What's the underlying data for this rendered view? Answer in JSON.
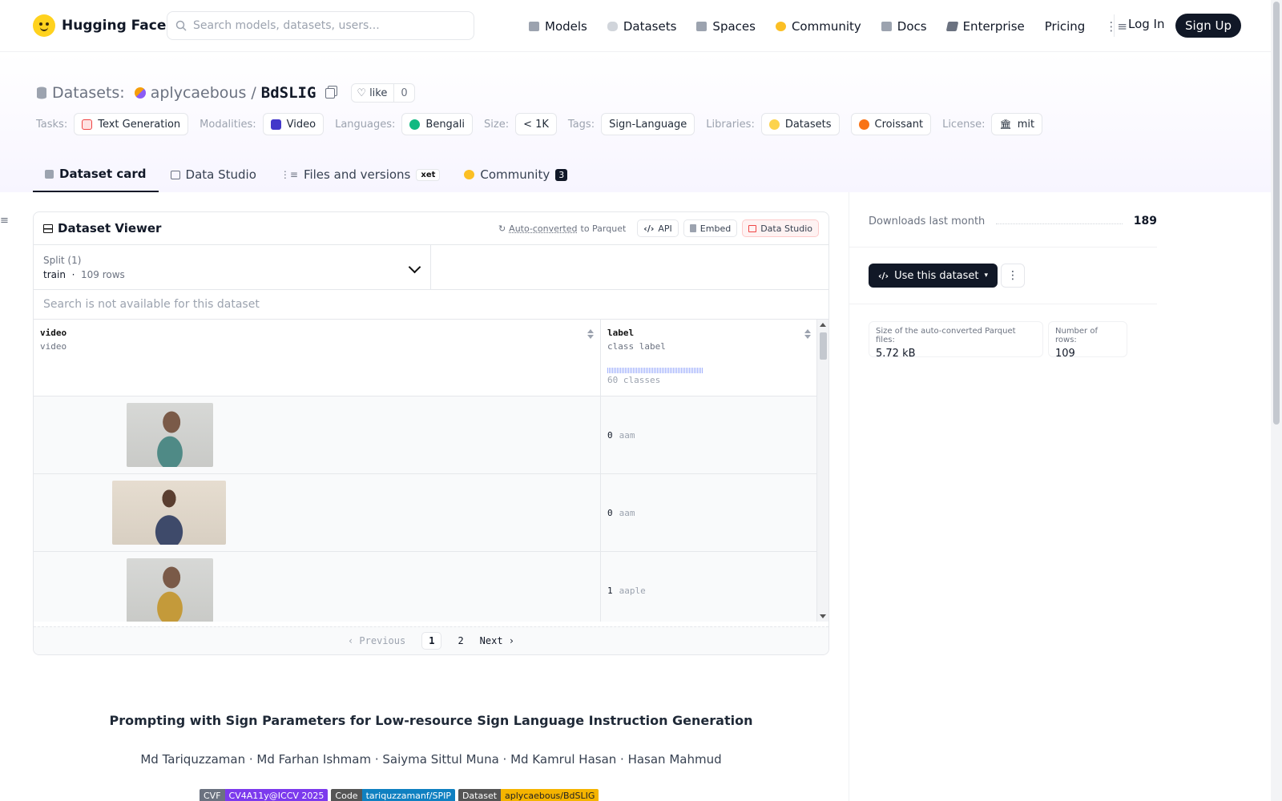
{
  "brand": {
    "name": "Hugging Face"
  },
  "search": {
    "placeholder": "Search models, datasets, users..."
  },
  "nav": {
    "items": [
      {
        "label": "Models",
        "icon": "cube-icon",
        "color": "#9ca3af"
      },
      {
        "label": "Datasets",
        "icon": "database-icon",
        "color": "#d1d5db"
      },
      {
        "label": "Spaces",
        "icon": "grid-icon",
        "color": "#9ca3af"
      },
      {
        "label": "Community",
        "icon": "community-icon",
        "color": "#fbbf24"
      },
      {
        "label": "Docs",
        "icon": "book-icon",
        "color": "#9ca3af"
      },
      {
        "label": "Enterprise",
        "icon": "enterprise-icon",
        "color": "#6b7280"
      },
      {
        "label": "Pricing",
        "icon": "",
        "color": ""
      }
    ],
    "login": "Log In",
    "signup": "Sign Up"
  },
  "header": {
    "section": "Datasets:",
    "owner": "aplycaebous",
    "slash": "/",
    "repo": "BdSLIG",
    "like_label": "like",
    "like_count": "0"
  },
  "tags": {
    "tasks_label": "Tasks:",
    "task": "Text Generation",
    "modalities_label": "Modalities:",
    "modality": "Video",
    "languages_label": "Languages:",
    "language": "Bengali",
    "size_label": "Size:",
    "size": "< 1K",
    "tags_label": "Tags:",
    "tag": "Sign-Language",
    "libraries_label": "Libraries:",
    "library1": "Datasets",
    "library2": "Croissant",
    "license_label": "License:",
    "license": "mit"
  },
  "tabs": {
    "card": "Dataset card",
    "studio": "Data Studio",
    "files": "Files and versions",
    "xet": "xet",
    "community": "Community",
    "community_count": "3"
  },
  "viewer": {
    "title": "Dataset Viewer",
    "auto_converted": "Auto-converted",
    "to_parquet": "to Parquet",
    "api": "API",
    "embed": "Embed",
    "data_studio": "Data Studio",
    "split_label": "Split (1)",
    "split_name": "train",
    "split_rows": "109 rows",
    "search_disabled": "Search is not available for this dataset",
    "columns": [
      {
        "name": "video",
        "type": "video"
      },
      {
        "name": "label",
        "type": "class label",
        "classes": "60 classes"
      }
    ],
    "rows": [
      {
        "label_id": "0",
        "label_name": "aam",
        "thumb": "woman-teal"
      },
      {
        "label_id": "0",
        "label_name": "aam",
        "thumb": "man-plaid"
      },
      {
        "label_id": "1",
        "label_name": "aaple",
        "thumb": "woman-yellow"
      }
    ],
    "pager": {
      "prev": "Previous",
      "pages": [
        "1",
        "2"
      ],
      "current": "1",
      "next": "Next"
    }
  },
  "sidebar": {
    "downloads_label": "Downloads last month",
    "downloads": "189",
    "use_button": "Use this dataset",
    "parquet_size_label": "Size of the auto-converted Parquet files:",
    "parquet_size": "5.72 kB",
    "rows_label": "Number of rows:",
    "rows": "109"
  },
  "card": {
    "title": "Prompting with Sign Parameters for Low-resource Sign Language Instruction Generation",
    "authors": "Md Tariquzzaman · Md Farhan Ishmam · Saiyma Sittul Muna · Md Kamrul Hasan · Hasan Mahmud",
    "badges": [
      {
        "left": "CVF",
        "right": "CV4A11y@ICCV 2025",
        "lcolor": "#6b7280",
        "rcolor": "#7c3aed"
      },
      {
        "left": "Code",
        "right": "tariquzzamanf/SPIP",
        "lcolor": "#555555",
        "rcolor": "#0f80c1"
      },
      {
        "left": "Dataset",
        "right": "aplycaebous/BdSLIG",
        "lcolor": "#555555",
        "rcolor": "#f5b400"
      }
    ]
  }
}
